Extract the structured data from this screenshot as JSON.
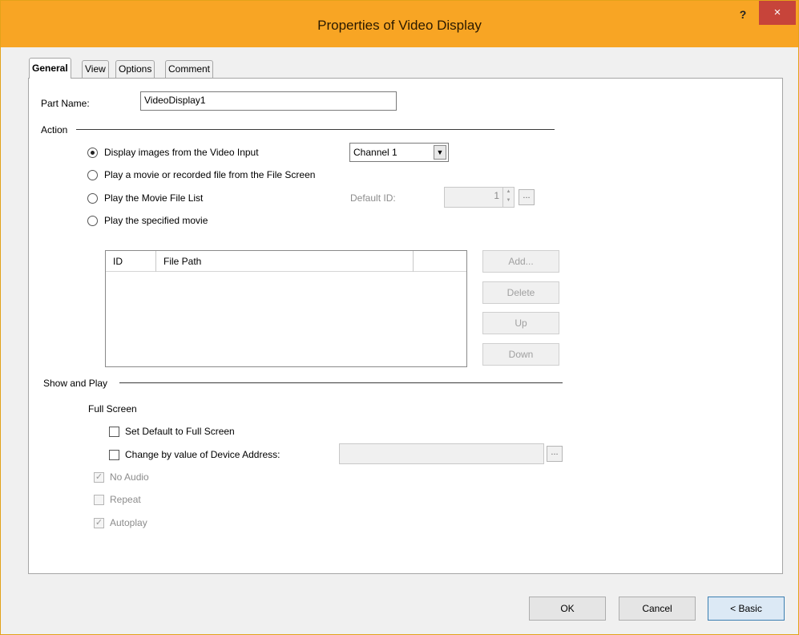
{
  "window": {
    "title": "Properties of Video Display",
    "help_label": "?",
    "close_label": "×"
  },
  "tabs": [
    {
      "label": "General",
      "active": true
    },
    {
      "label": "View",
      "active": false
    },
    {
      "label": "Options",
      "active": false
    },
    {
      "label": "Comment",
      "active": false
    }
  ],
  "part_name": {
    "label": "Part Name:",
    "value": "VideoDisplay1"
  },
  "action": {
    "heading": "Action",
    "options": [
      {
        "label": "Display images from the Video Input",
        "checked": true
      },
      {
        "label": "Play a movie or recorded file from the File Screen",
        "checked": false
      },
      {
        "label": "Play the Movie File List",
        "checked": false
      },
      {
        "label": "Play the specified movie",
        "checked": false
      }
    ],
    "channel_select": "Channel 1",
    "default_id_label": "Default ID:",
    "default_id_value": "1",
    "browse_label": "...",
    "table": {
      "columns": [
        "ID",
        "File Path"
      ]
    },
    "buttons": {
      "add": "Add...",
      "delete": "Delete",
      "up": "Up",
      "down": "Down"
    }
  },
  "show_and_play": {
    "heading": "Show and Play",
    "full_screen_label": "Full Screen",
    "set_default_full": {
      "label": "Set Default to Full Screen",
      "checked": false
    },
    "change_by_device": {
      "label": "Change by value of Device Address:",
      "checked": false,
      "value": ""
    },
    "browse_label": "...",
    "no_audio": {
      "label": "No Audio",
      "checked": true
    },
    "repeat": {
      "label": "Repeat",
      "checked": false
    },
    "autoplay": {
      "label": "Autoplay",
      "checked": true
    }
  },
  "footer": {
    "ok": "OK",
    "cancel": "Cancel",
    "basic": "< Basic"
  }
}
